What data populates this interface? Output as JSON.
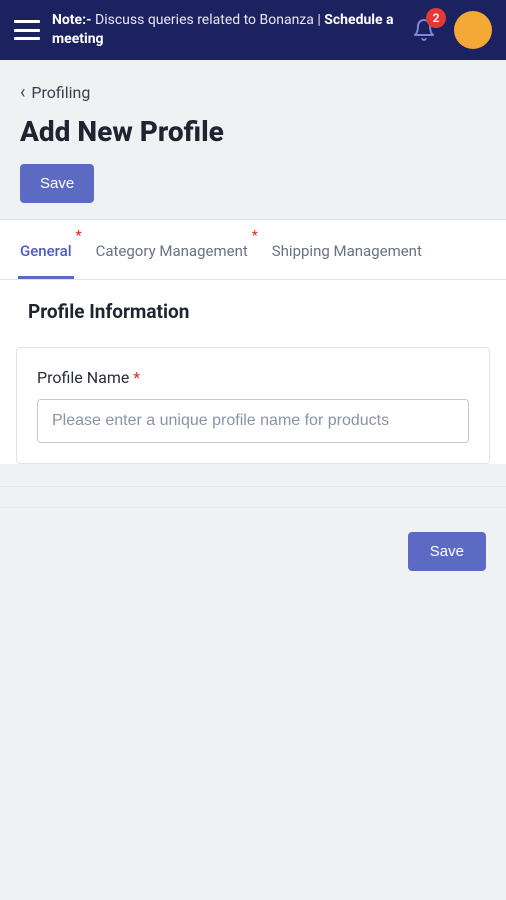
{
  "header": {
    "note_prefix": "Note:-",
    "note_text": "Discuss queries related to Bonanza |",
    "schedule_label": "Schedule a meeting",
    "notification_count": "2"
  },
  "breadcrumb": {
    "label": "Profiling"
  },
  "page": {
    "title": "Add New Profile",
    "save_label": "Save"
  },
  "tabs": [
    {
      "label": "General",
      "required": true,
      "active": true
    },
    {
      "label": "Category Management",
      "required": true,
      "active": false
    },
    {
      "label": "Shipping Management",
      "required": false,
      "active": false
    }
  ],
  "section": {
    "title": "Profile Information"
  },
  "fields": {
    "profile_name": {
      "label": "Profile Name",
      "required_mark": "*",
      "placeholder": "Please enter a unique profile name for products",
      "value": ""
    }
  },
  "footer": {
    "save_label": "Save"
  }
}
